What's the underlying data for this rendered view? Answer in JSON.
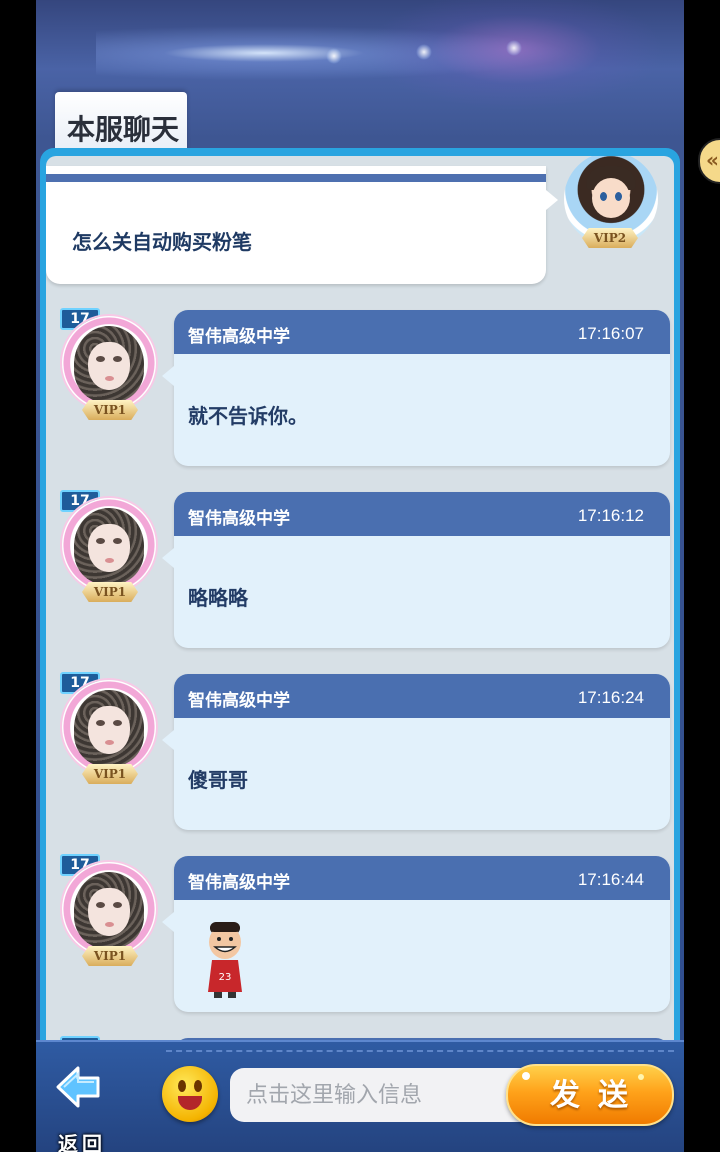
{
  "header": {
    "title": "本服聊天"
  },
  "own_message": {
    "text": "怎么关自动购买粉笔",
    "vip": "VIP2"
  },
  "messages": [
    {
      "level": "17",
      "vip": "VIP1",
      "sender": "智伟高级中学",
      "time": "17:16:07",
      "text": "就不告诉你。"
    },
    {
      "level": "17",
      "vip": "VIP1",
      "sender": "智伟高级中学",
      "time": "17:16:12",
      "text": "略略略"
    },
    {
      "level": "17",
      "vip": "VIP1",
      "sender": "智伟高级中学",
      "time": "17:16:24",
      "text": "傻哥哥"
    },
    {
      "level": "17",
      "vip": "VIP1",
      "sender": "智伟高级中学",
      "time": "17:16:44",
      "text": "",
      "sticker": "smiling-boy-sticker"
    }
  ],
  "footer": {
    "back_label": "返回",
    "input_placeholder": "点击这里输入信息",
    "send_label": "发送"
  },
  "icons": {
    "back": "blue-arrow-left-icon",
    "emoji": "yellow-smiley-icon",
    "collapse": "double-chevron-left-icon"
  },
  "colors": {
    "panel_border": "#29a4e0",
    "bubble_header": "#4a6fb0",
    "bubble_body": "#e2f1fb",
    "send_button": "#ffa21a"
  }
}
